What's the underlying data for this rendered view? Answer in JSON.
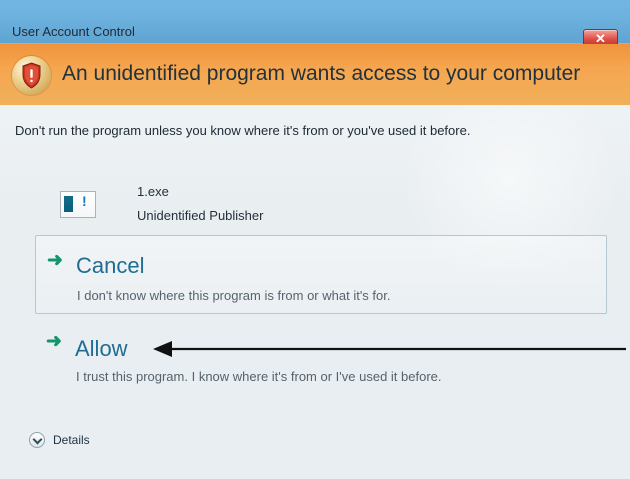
{
  "window": {
    "title": "User Account Control",
    "close_icon": "close-icon",
    "colors": {
      "titlebar": "#6eb2df",
      "banner": "#f5a64f",
      "accent": "#216d92",
      "arrow_green": "#13956a",
      "close_red": "#de5148"
    }
  },
  "banner": {
    "icon": "shield-icon",
    "title": "An unidentified program wants access to your computer"
  },
  "message": "Don't run the program unless you know where it's from or you've used it before.",
  "program": {
    "icon": "program-icon",
    "name": "1.exe",
    "publisher": "Unidentified Publisher"
  },
  "options": [
    {
      "icon": "arrow-right-icon",
      "label": "Cancel",
      "description": "I don't know where this program is from or what it's for."
    },
    {
      "icon": "arrow-right-icon",
      "label": "Allow",
      "description": "I trust this program. I know where it's from or I've used it before."
    }
  ],
  "details": {
    "icon": "chevron-down-icon",
    "label": "Details"
  }
}
